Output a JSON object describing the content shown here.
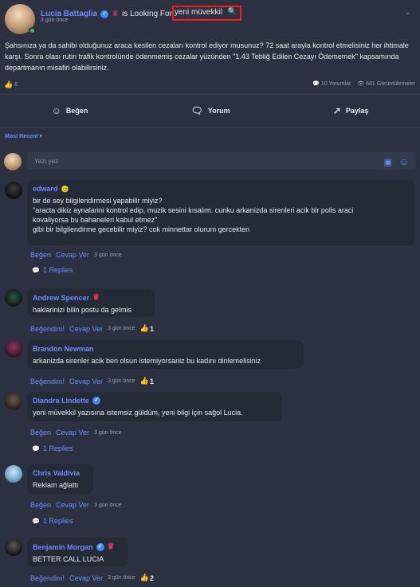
{
  "post": {
    "author": "Lucia Battaglia",
    "action": "is Looking For",
    "looking_for": "yeni müvekkil",
    "time": "3 gün önce",
    "body": "Şahsınıza ya da sahibi olduğunuz araca kesilen cezaları kontrol ediyor musunuz? 72 saat arayla kontrol etmelisiniz her ihtimale karşı. Sonra olası rutin trafik kontrolünde ödenmemiş cezalar yüzünden \"1.43 Tebliğ Edilen Cezayı Ödememek\" kapsamında departmanın misafiri olabilirsiniz.",
    "likes": "6",
    "comments_count": "10 Yorumlar",
    "views": "681 Görüntülemeler"
  },
  "actions": {
    "like": "Beğen",
    "comment": "Yorum",
    "share": "Paylaş"
  },
  "sort": {
    "label": "Most Recent"
  },
  "comment_input": {
    "placeholder": "Yazı yaz"
  },
  "comments": [
    {
      "author": "edward",
      "lines": [
        "bir de sey bilgilendirmesi yapabilir miyiz?",
        "\"aracta dikiz aynalarini kontrol edip, muzik sesini kısalım. cunku arkanizda sirenleri acik bir polis araci",
        "kovaliyorsa bu bahaneleri kabul etmez\"",
        "gibi bir bilgilendirme gecebilir miyiz? cok minnettar olurum gercekten"
      ],
      "like_label": "Beğen",
      "reply_label": "Cevap Ver",
      "time": "3 gün önce",
      "replies": "1 Replies"
    },
    {
      "author": "Andrew Spencer",
      "lines": [
        "haklarinizi bilin postu da gelmis"
      ],
      "like_label": "Beğendim!",
      "reply_label": "Cevap Ver",
      "time": "3 gün önce",
      "likes": "1"
    },
    {
      "author": "Brandon Newman",
      "lines": [
        "arkanizda sirenler acik ben olsun istemiyorsaniz bu kadını dinlemelisiniz"
      ],
      "like_label": "Beğendim!",
      "reply_label": "Cevap Ver",
      "time": "3 gün önce",
      "likes": "1"
    },
    {
      "author": "Diandra Lindette",
      "lines": [
        "yeni müvekkil yazısına istemsiz güldüm, yeni bilgi için sağol Lucia."
      ],
      "like_label": "Beğen",
      "reply_label": "Cevap Ver",
      "time": "3 gün önce",
      "replies": "1 Replies"
    },
    {
      "author": "Chris Valdivia",
      "lines": [
        "Reklam ağlattı"
      ],
      "like_label": "Beğen",
      "reply_label": "Cevap Ver",
      "time": "3 gün önce",
      "replies": "1 Replies"
    },
    {
      "author": "Benjamin Morgan",
      "lines": [
        "BETTER CALL LUCIA"
      ],
      "like_label": "Beğendim!",
      "reply_label": "Cevap Ver",
      "time": "3 gün önce",
      "likes": "2"
    }
  ],
  "colors": {
    "accent": "#6d8cff",
    "background": "#2b3140",
    "bubble": "#242a36",
    "highlight": "#ff1a1a"
  }
}
